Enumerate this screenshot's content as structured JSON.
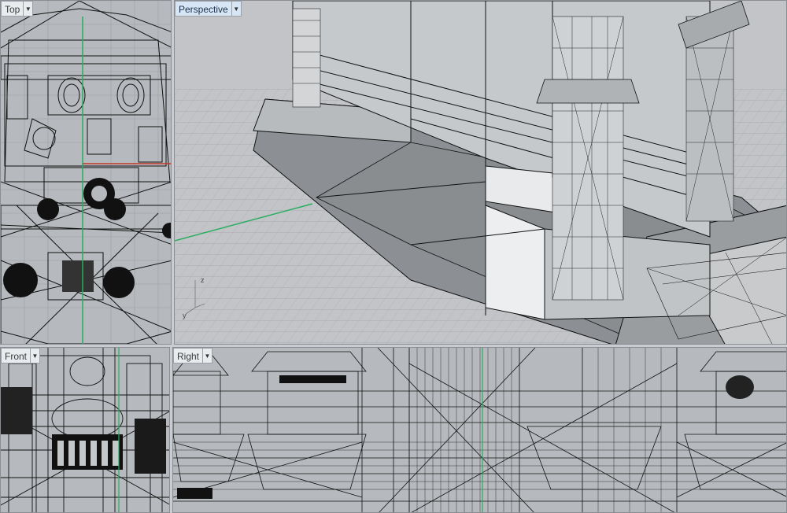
{
  "viewports": {
    "top": {
      "label": "Top",
      "dropdown_icon": "triangle-down"
    },
    "perspective": {
      "label": "Perspective",
      "dropdown_icon": "triangle-down"
    },
    "front": {
      "label": "Front",
      "dropdown_icon": "triangle-down"
    },
    "right": {
      "label": "Right",
      "dropdown_icon": "triangle-down"
    }
  },
  "axis_gizmo": {
    "z": "z",
    "y": "y"
  },
  "colors": {
    "background": "#c9ccd1",
    "viewport_bg": "#b6b9bd",
    "active_tab": "#d6e6f5",
    "wire": "#111111",
    "x_axis": "#c0392b",
    "y_axis": "#27ae60"
  }
}
